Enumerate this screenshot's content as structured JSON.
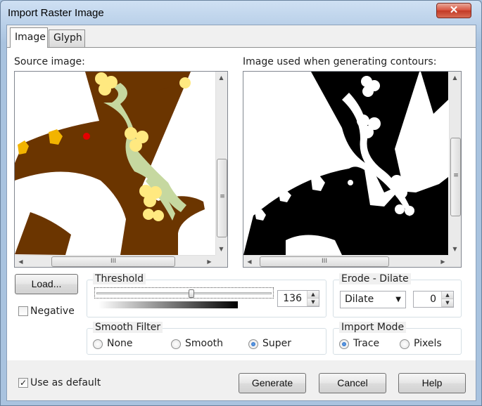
{
  "window": {
    "title": "Import Raster Image",
    "close_glyph": "✕"
  },
  "tabs": [
    {
      "label": "Image",
      "active": true
    },
    {
      "label": "Glyph",
      "active": false
    }
  ],
  "source": {
    "label": "Source image:"
  },
  "contours": {
    "label": "Image used when generating contours:"
  },
  "load_button": {
    "label": "Load..."
  },
  "negative": {
    "label": "Negative",
    "checked": false
  },
  "threshold": {
    "label": "Threshold",
    "value": "136",
    "level": 136,
    "max": 255
  },
  "erode_dilate": {
    "label": "Erode - Dilate",
    "mode": "Dilate",
    "amount": "0"
  },
  "smooth_filter": {
    "label": "Smooth Filter",
    "options": [
      {
        "label": "None",
        "selected": false
      },
      {
        "label": "Smooth",
        "selected": false
      },
      {
        "label": "Super",
        "selected": true
      }
    ]
  },
  "import_mode": {
    "label": "Import Mode",
    "options": [
      {
        "label": "Trace",
        "selected": true
      },
      {
        "label": "Pixels",
        "selected": false
      }
    ]
  },
  "use_default": {
    "label": "Use as default",
    "checked": true
  },
  "buttons": {
    "generate": "Generate",
    "cancel": "Cancel",
    "help": "Help"
  },
  "colors": {
    "brown": "#6b3500",
    "sage": "#c6d8a0",
    "yellow": "#ffe980",
    "gold": "#f2b400",
    "red": "#e40000"
  },
  "icons": {
    "scroll_up": "▲",
    "scroll_down": "▼",
    "scroll_left": "◀",
    "scroll_right": "▶",
    "grip": "III",
    "dropdown": "▼",
    "check": "✓"
  }
}
